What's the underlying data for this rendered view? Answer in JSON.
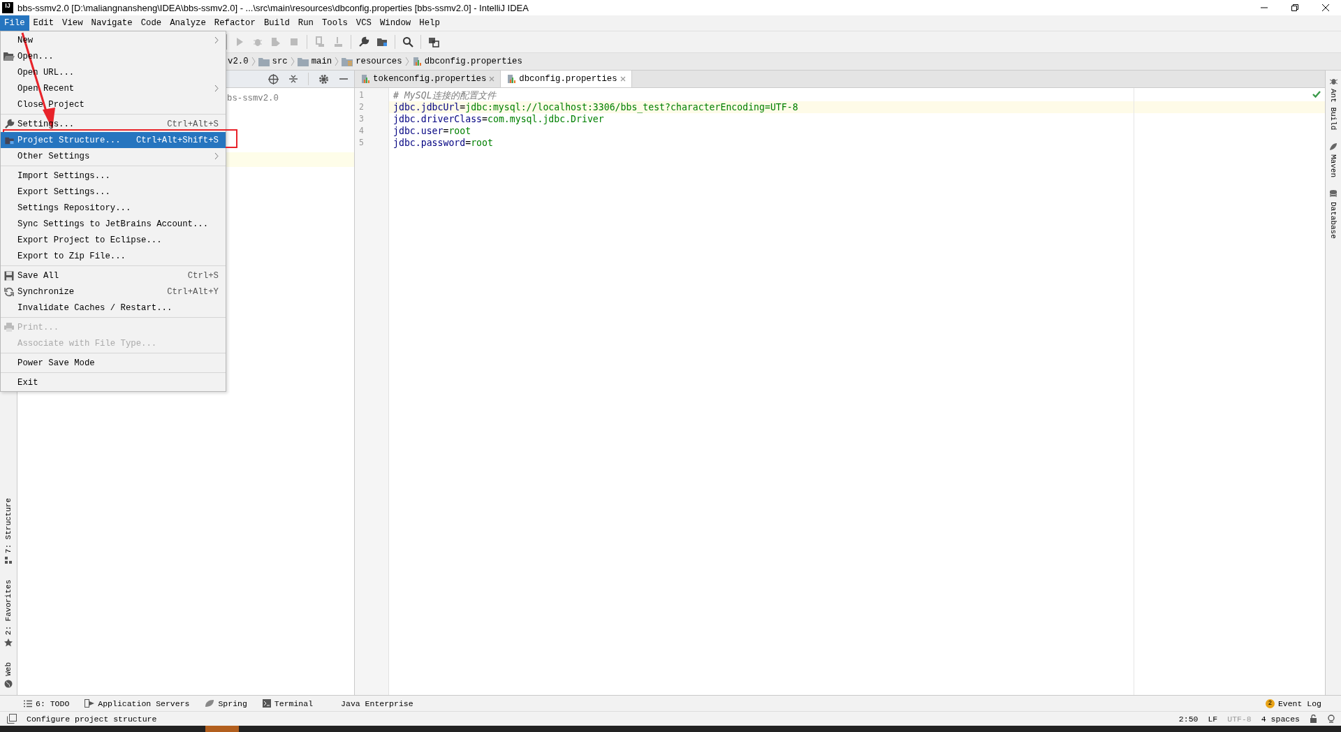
{
  "window": {
    "logo": "IJ",
    "title": "bbs-ssmv2.0 [D:\\maliangnansheng\\IDEA\\bbs-ssmv2.0] - ...\\src\\main\\resources\\dbconfig.properties [bbs-ssmv2.0] - IntelliJ IDEA"
  },
  "menu_bar": [
    {
      "label": "File",
      "selected": true
    },
    {
      "label": "Edit",
      "selected": false
    },
    {
      "label": "View",
      "selected": false
    },
    {
      "label": "Navigate",
      "selected": false
    },
    {
      "label": "Code",
      "selected": false
    },
    {
      "label": "Analyze",
      "selected": false
    },
    {
      "label": "Refactor",
      "selected": false
    },
    {
      "label": "Build",
      "selected": false
    },
    {
      "label": "Run",
      "selected": false
    },
    {
      "label": "Tools",
      "selected": false
    },
    {
      "label": "VCS",
      "selected": false
    },
    {
      "label": "Window",
      "selected": false
    },
    {
      "label": "Help",
      "selected": false
    }
  ],
  "file_menu": {
    "groups": [
      [
        {
          "label": "New",
          "submenu": true,
          "disabled": false,
          "selected": false
        },
        {
          "label": "Open...",
          "submenu": false,
          "disabled": false,
          "selected": false
        },
        {
          "label": "Open URL...",
          "submenu": false,
          "disabled": false,
          "selected": false
        },
        {
          "label": "Open Recent",
          "submenu": true,
          "disabled": false,
          "selected": false
        },
        {
          "label": "Close Project",
          "submenu": false,
          "disabled": false,
          "selected": false
        }
      ],
      [
        {
          "label": "Settings...",
          "shortcut": "Ctrl+Alt+S",
          "submenu": false,
          "disabled": false,
          "selected": false
        },
        {
          "label": "Project Structure...",
          "shortcut": "Ctrl+Alt+Shift+S",
          "submenu": false,
          "disabled": false,
          "selected": true
        },
        {
          "label": "Other Settings",
          "submenu": true,
          "disabled": false,
          "selected": false
        }
      ],
      [
        {
          "label": "Import Settings...",
          "submenu": false,
          "disabled": false,
          "selected": false
        },
        {
          "label": "Export Settings...",
          "submenu": false,
          "disabled": false,
          "selected": false
        },
        {
          "label": "Settings Repository...",
          "submenu": false,
          "disabled": false,
          "selected": false
        },
        {
          "label": "Sync Settings to JetBrains Account...",
          "submenu": false,
          "disabled": false,
          "selected": false
        },
        {
          "label": "Export Project to Eclipse...",
          "submenu": false,
          "disabled": false,
          "selected": false
        },
        {
          "label": "Export to Zip File...",
          "submenu": false,
          "disabled": false,
          "selected": false
        }
      ],
      [
        {
          "label": "Save All",
          "shortcut": "Ctrl+S",
          "submenu": false,
          "disabled": false,
          "selected": false
        },
        {
          "label": "Synchronize",
          "shortcut": "Ctrl+Alt+Y",
          "submenu": false,
          "disabled": false,
          "selected": false
        },
        {
          "label": "Invalidate Caches / Restart...",
          "submenu": false,
          "disabled": false,
          "selected": false
        }
      ],
      [
        {
          "label": "Print...",
          "submenu": false,
          "disabled": true,
          "selected": false
        },
        {
          "label": "Associate with File Type...",
          "submenu": false,
          "disabled": true,
          "selected": false
        }
      ],
      [
        {
          "label": "Power Save Mode",
          "submenu": false,
          "disabled": false,
          "selected": false
        }
      ],
      [
        {
          "label": "Exit",
          "submenu": false,
          "disabled": false,
          "selected": false
        }
      ]
    ]
  },
  "breadcrumb": [
    "v2.0",
    "src",
    "main",
    "resources",
    "dbconfig.properties"
  ],
  "project_panel": {
    "tree": [
      {
        "label": "bs-ssmv2.0"
      }
    ]
  },
  "editor_tabs": [
    {
      "label": "tokenconfig.properties",
      "selected": false
    },
    {
      "label": "dbconfig.properties",
      "selected": true
    }
  ],
  "editor": {
    "lines": [
      {
        "number": "1",
        "kind": "comment",
        "text": "# MySQL连接的配置文件",
        "current": false
      },
      {
        "number": "2",
        "kind": "property",
        "key": "jdbc.jdbcUrl",
        "separator": "=",
        "value": "jdbc:mysql://localhost:3306/bbs_test?characterEncoding=UTF-8",
        "current": true
      },
      {
        "number": "3",
        "kind": "property",
        "key": "jdbc.driverClass",
        "separator": "=",
        "value": "com.mysql.jdbc.Driver",
        "current": false
      },
      {
        "number": "4",
        "kind": "property",
        "key": "jdbc.user",
        "separator": "=",
        "value": "root",
        "current": false
      },
      {
        "number": "5",
        "kind": "property",
        "key": "jdbc.password",
        "separator": "=",
        "value": "root",
        "current": false
      }
    ]
  },
  "left_stripe": [
    "7: Structure",
    "2: Favorites",
    "Web"
  ],
  "right_stripe": [
    "Ant Build",
    "Maven",
    "Database"
  ],
  "bottom_tools": [
    "6: TODO",
    "Application Servers",
    "Spring",
    "Terminal",
    "Java Enterprise"
  ],
  "event_log": {
    "count": "2",
    "label": "Event Log"
  },
  "status_bar": {
    "message": "Configure project structure",
    "position": "2:50",
    "line_separator": "LF",
    "encoding": "UTF-8",
    "indent": "4 spaces"
  }
}
